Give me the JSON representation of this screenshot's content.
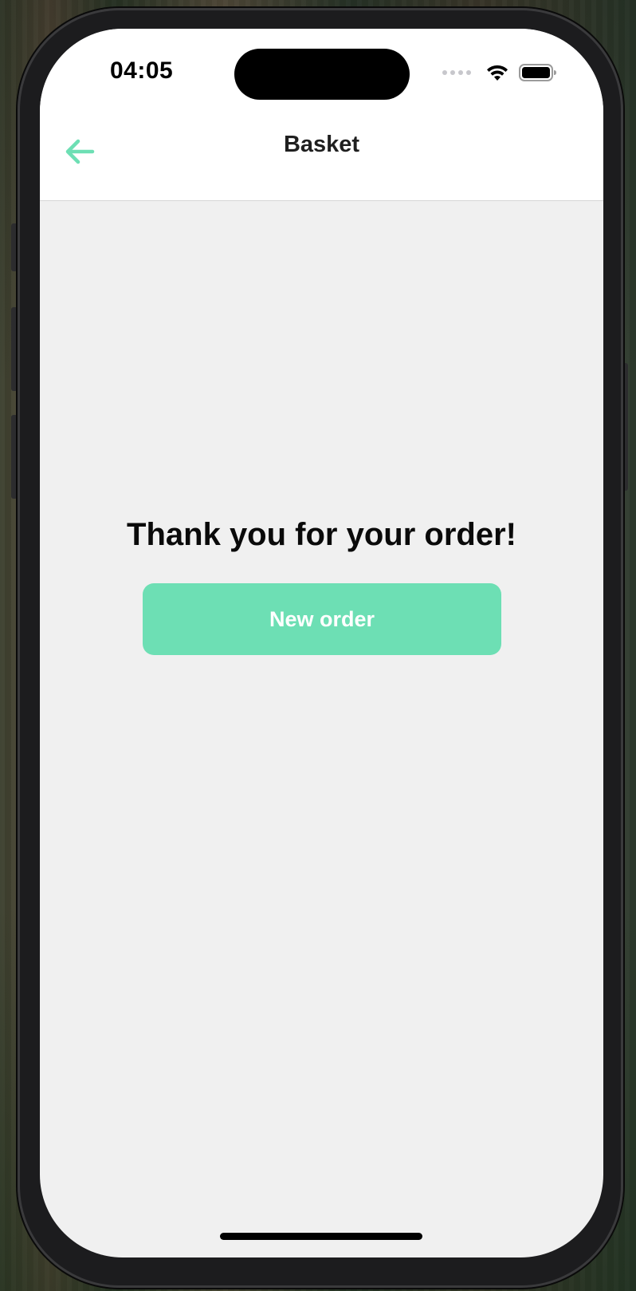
{
  "status_bar": {
    "time": "04:05",
    "icons": [
      "cellular-dots-icon",
      "wifi-icon",
      "battery-icon"
    ]
  },
  "nav": {
    "back_icon": "arrow-left-icon",
    "title": "Basket"
  },
  "main": {
    "message": "Thank you for your order!",
    "new_order_label": "New order"
  },
  "colors": {
    "accent": "#6ddfb4",
    "background": "#f0f0f0",
    "nav_background": "#ffffff",
    "title_text": "#1f1f1f",
    "button_text": "#ffffff"
  }
}
